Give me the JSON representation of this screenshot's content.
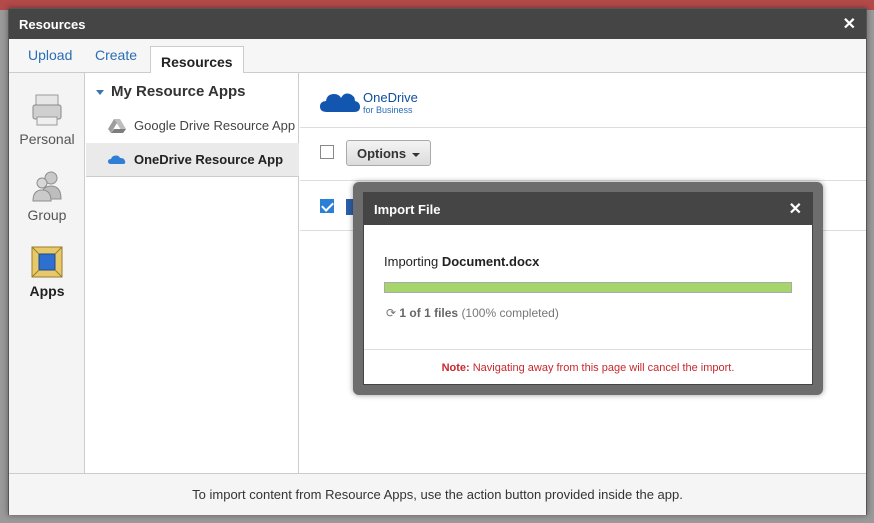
{
  "window": {
    "title": "Resources",
    "close_glyph": "✕"
  },
  "tabs": [
    {
      "label": "Upload"
    },
    {
      "label": "Create"
    },
    {
      "label": "Resources",
      "active": true
    }
  ],
  "leftnav": {
    "items": [
      {
        "label": "Personal",
        "icon": "printer-icon"
      },
      {
        "label": "Group",
        "icon": "people-icon"
      },
      {
        "label": "Apps",
        "icon": "apps-icon",
        "active": true
      }
    ]
  },
  "apps": {
    "header": "My Resource Apps",
    "items": [
      {
        "label": "Google Drive Resource App",
        "icon": "google-drive-icon"
      },
      {
        "label": "OneDrive Resource App",
        "icon": "onedrive-icon",
        "selected": true
      }
    ]
  },
  "content": {
    "brand": {
      "line1": "OneDrive",
      "line2": "for Business"
    },
    "options_label": "Options"
  },
  "footer": {
    "text": "To import content from Resource Apps, use the action button provided inside the app."
  },
  "modal": {
    "title": "Import File",
    "close_glyph": "✕",
    "importing_prefix": "Importing",
    "filename": "Document.docx",
    "progress_percent": 100,
    "status_count": "1 of 1 files",
    "status_pct": "(100% completed)",
    "note_label": "Note:",
    "note_text": "Navigating away from this page will cancel the import."
  },
  "colors": {
    "accent": "#2a6db5",
    "progress": "#a6d66b",
    "warning": "#c8282f",
    "header": "#454545"
  }
}
